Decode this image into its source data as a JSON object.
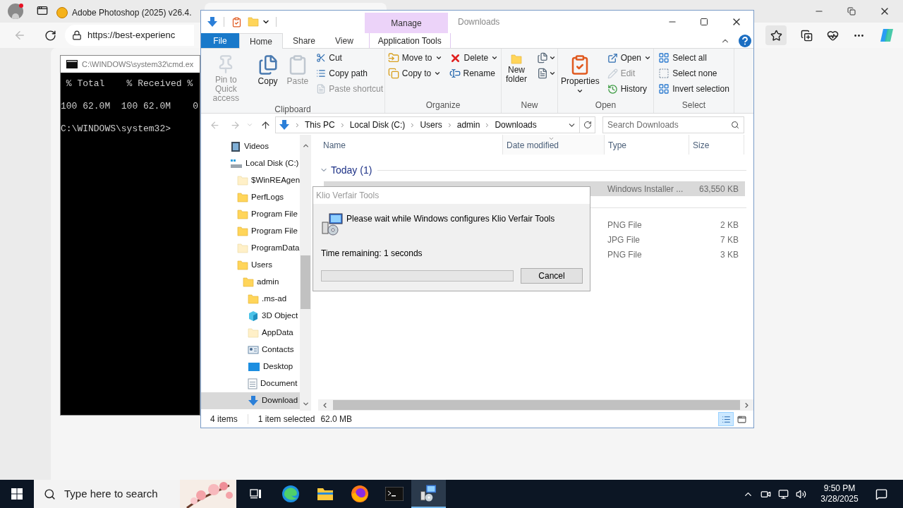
{
  "browser": {
    "tabs": [
      {
        "title": "Adobe Photoshop (2025) v26.4.",
        "selected": false
      },
      {
        "selected": true
      }
    ],
    "url": "https://best-experienc"
  },
  "console": {
    "title": "C:\\WINDOWS\\system32\\cmd.ex",
    "lines": [
      " % Total    % Received %",
      "100 62.0M  100 62.0M    0",
      "C:\\WINDOWS\\system32>"
    ]
  },
  "explorer": {
    "title": "Downloads",
    "context_header": "Manage",
    "tabs": [
      {
        "label": "File",
        "kind": "file",
        "selected": false
      },
      {
        "label": "Home",
        "kind": "tab",
        "selected": true
      },
      {
        "label": "Share",
        "kind": "tab",
        "selected": false
      },
      {
        "label": "View",
        "kind": "tab",
        "selected": false
      },
      {
        "label": "Application Tools",
        "kind": "context",
        "selected": false
      }
    ],
    "ribbon": [
      {
        "label": "Clipboard",
        "columns": [
          [
            {
              "label": "Pin to Quick access",
              "kind": "large",
              "disabled": true
            }
          ],
          [
            {
              "label": "Copy",
              "kind": "large",
              "disabled": false
            }
          ],
          [
            {
              "label": "Paste",
              "kind": "large",
              "disabled": true
            }
          ],
          [
            {
              "label": "Cut",
              "kind": "small",
              "disabled": false
            },
            {
              "label": "Copy path",
              "kind": "small",
              "disabled": false
            },
            {
              "label": "Paste shortcut",
              "kind": "small",
              "disabled": true
            }
          ]
        ]
      },
      {
        "label": "Organize",
        "columns": [
          [
            {
              "label": "Move to",
              "kind": "small",
              "disabled": false,
              "dropdown": true
            },
            {
              "label": "Copy to",
              "kind": "small",
              "disabled": false,
              "dropdown": true
            }
          ],
          [
            {
              "label": "Delete",
              "kind": "small",
              "disabled": false,
              "dropdown": true
            },
            {
              "label": "Rename",
              "kind": "small",
              "disabled": false
            }
          ]
        ]
      },
      {
        "label": "New",
        "columns": [
          [
            {
              "label": "New folder",
              "kind": "large",
              "disabled": false
            }
          ],
          [
            {
              "kind": "icon",
              "disabled": false,
              "dropdown": true
            },
            {
              "kind": "icon",
              "disabled": false,
              "dropdown": true
            }
          ]
        ]
      },
      {
        "label": "Open",
        "columns": [
          [
            {
              "label": "Properties",
              "kind": "large",
              "disabled": false,
              "dropdown": true
            }
          ],
          [
            {
              "label": "Open",
              "kind": "small",
              "disabled": false,
              "dropdown": true
            },
            {
              "label": "Edit",
              "kind": "small",
              "disabled": true
            },
            {
              "label": "History",
              "kind": "small",
              "disabled": false
            }
          ]
        ]
      },
      {
        "label": "Select",
        "columns": [
          [
            {
              "label": "Select all",
              "kind": "small",
              "disabled": false
            },
            {
              "label": "Select none",
              "kind": "small",
              "disabled": false
            },
            {
              "label": "Invert selection",
              "kind": "small",
              "disabled": false
            }
          ]
        ]
      }
    ],
    "path": [
      "This PC",
      "Local Disk (C:)",
      "Users",
      "admin",
      "Downloads"
    ],
    "search": {
      "placeholder": "Search Downloads"
    },
    "tree": [
      {
        "label": "Videos",
        "kind": "videos",
        "selected": false
      },
      {
        "label": "Local Disk (C:)",
        "kind": "drive",
        "selected": false,
        "children": [
          {
            "label": "$WinREAgen",
            "kind": "hidden_folder",
            "selected": false
          },
          {
            "label": "PerfLogs",
            "kind": "folder",
            "selected": false
          },
          {
            "label": "Program File",
            "kind": "folder",
            "selected": false
          },
          {
            "label": "Program File",
            "kind": "folder",
            "selected": false
          },
          {
            "label": "ProgramData",
            "kind": "hidden_folder",
            "selected": false
          },
          {
            "label": "Users",
            "kind": "folder",
            "selected": false,
            "children": [
              {
                "label": "admin",
                "kind": "folder",
                "selected": false,
                "children": [
                  {
                    "label": ".ms-ad",
                    "kind": "folder",
                    "selected": false
                  },
                  {
                    "label": "3D Object",
                    "kind": "cube",
                    "selected": false
                  },
                  {
                    "label": "AppData",
                    "kind": "hidden_folder",
                    "selected": false
                  },
                  {
                    "label": "Contacts",
                    "kind": "contacts",
                    "selected": false
                  },
                  {
                    "label": "Desktop",
                    "kind": "desktop",
                    "selected": false
                  },
                  {
                    "label": "Document",
                    "kind": "documents",
                    "selected": false
                  },
                  {
                    "label": "Download",
                    "kind": "downloads",
                    "selected": true
                  }
                ]
              }
            ]
          }
        ]
      }
    ],
    "columns": [
      {
        "label": "Name",
        "sorted": false
      },
      {
        "label": "Date modified",
        "sorted": true
      },
      {
        "label": "Type",
        "sorted": false
      },
      {
        "label": "Size",
        "sorted": false
      }
    ],
    "groups": [
      {
        "label": "Today (1)",
        "expanded": true,
        "rows": [
          {
            "type": "Windows Installer ...",
            "size": "63,550 KB",
            "selected": true
          }
        ]
      },
      {
        "rows": [
          {
            "type": "PNG File",
            "size": "2 KB",
            "selected": false
          },
          {
            "type": "JPG File",
            "size": "7 KB",
            "selected": false
          },
          {
            "type": "PNG File",
            "size": "3 KB",
            "selected": false
          }
        ]
      }
    ],
    "status": {
      "count": "4 items",
      "selection": "1 item selected",
      "size": "62.0 MB"
    },
    "views": [
      {
        "selected": true
      },
      {
        "selected": false
      }
    ]
  },
  "dialog": {
    "title": "Klio Verfair Tools",
    "message": "Please wait while Windows configures Klio Verfair Tools",
    "remaining": "Time remaining: 1 seconds",
    "level": 0,
    "button": "Cancel"
  },
  "taskbar": {
    "search_placeholder": "Type here to search",
    "apps": [
      {
        "selected": false
      },
      {
        "selected": false
      },
      {
        "selected": false
      },
      {
        "selected": false
      },
      {
        "selected": false
      },
      {
        "selected": true
      }
    ],
    "time": "9:50 PM",
    "date": "3/28/2025"
  }
}
